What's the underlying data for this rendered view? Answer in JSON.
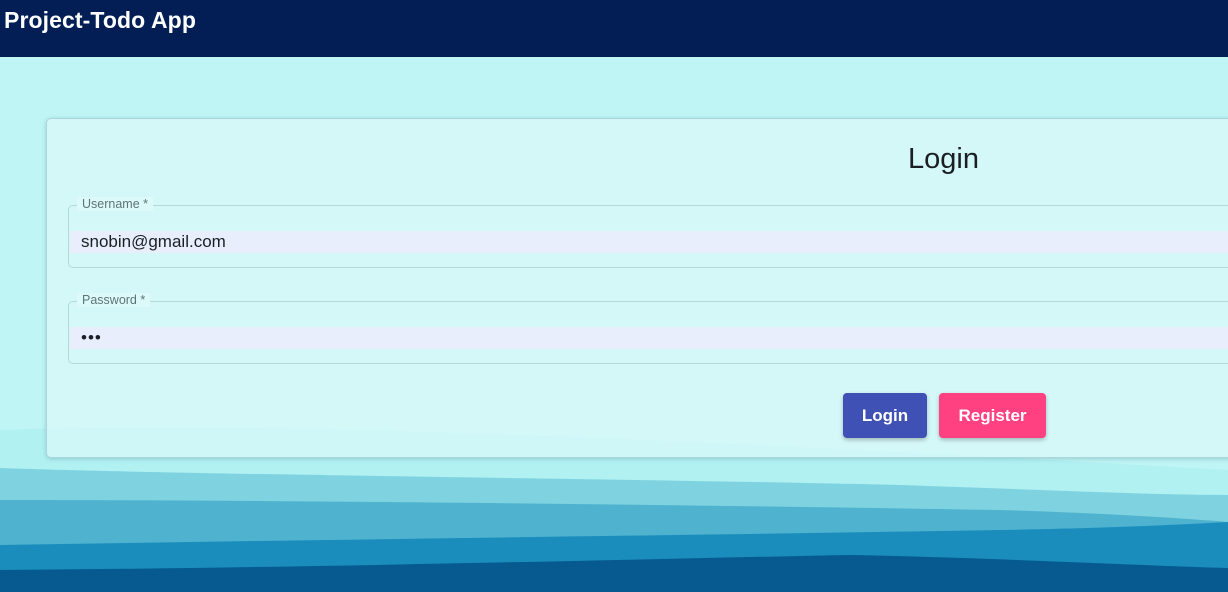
{
  "app": {
    "title": "Project-Todo App"
  },
  "login_card": {
    "title": "Login",
    "username": {
      "label": "Username *",
      "value": "snobin@gmail.com"
    },
    "password": {
      "label": "Password *",
      "value": "•••"
    },
    "buttons": {
      "login_label": "Login",
      "register_label": "Register"
    }
  },
  "colors": {
    "appbar": "#021e54",
    "background": "#bff5f5",
    "login_button": "#3f51b5",
    "register_button": "#ff4081",
    "input_fill": "#e8eefc"
  }
}
